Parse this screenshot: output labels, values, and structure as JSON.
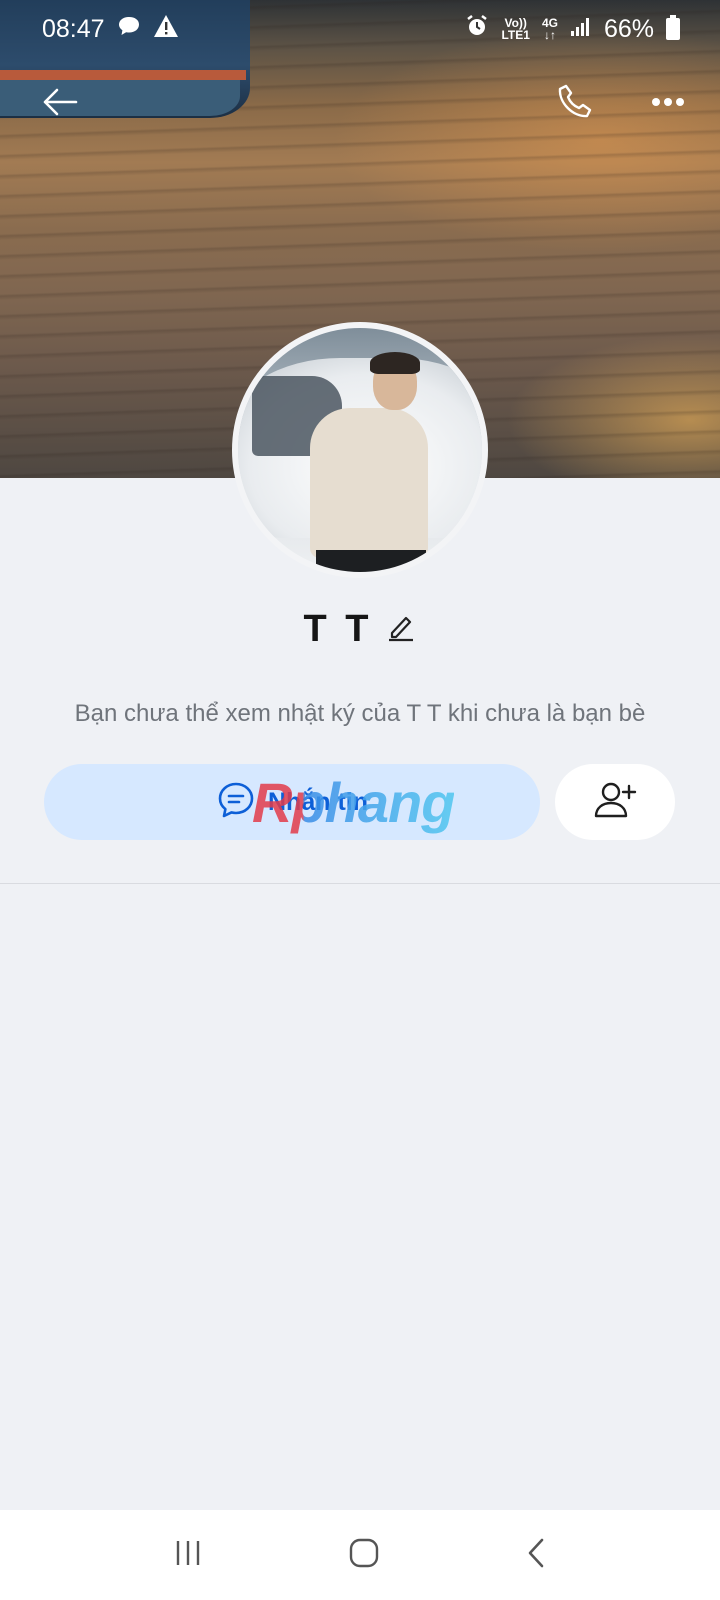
{
  "status_bar": {
    "time": "08:47",
    "network_top": "Vo))",
    "network_bottom": "LTE1",
    "data_type": "4G",
    "battery": "66%",
    "icons": [
      "message-bubble-icon",
      "warning-icon",
      "alarm-icon",
      "signal-icon",
      "battery-icon"
    ]
  },
  "header": {
    "back_icon": "back-arrow-icon",
    "call_icon": "phone-icon",
    "more_icon": "more-horizontal-icon"
  },
  "profile": {
    "name": "T T",
    "edit_icon": "pencil-icon",
    "privacy_note": "Bạn chưa thể xem nhật ký của T T khi chưa là bạn bè"
  },
  "actions": {
    "message_label": "Nhắn tin",
    "message_icon": "chat-bubble-icon",
    "add_friend_icon": "add-user-icon"
  },
  "watermark": "Rphang",
  "nav_bar": {
    "icons": [
      "recent-apps-icon",
      "home-icon",
      "back-icon"
    ]
  },
  "colors": {
    "background": "#eff1f5",
    "accent": "#0d5fd7",
    "message_button_bg": "#d6e8ff"
  }
}
